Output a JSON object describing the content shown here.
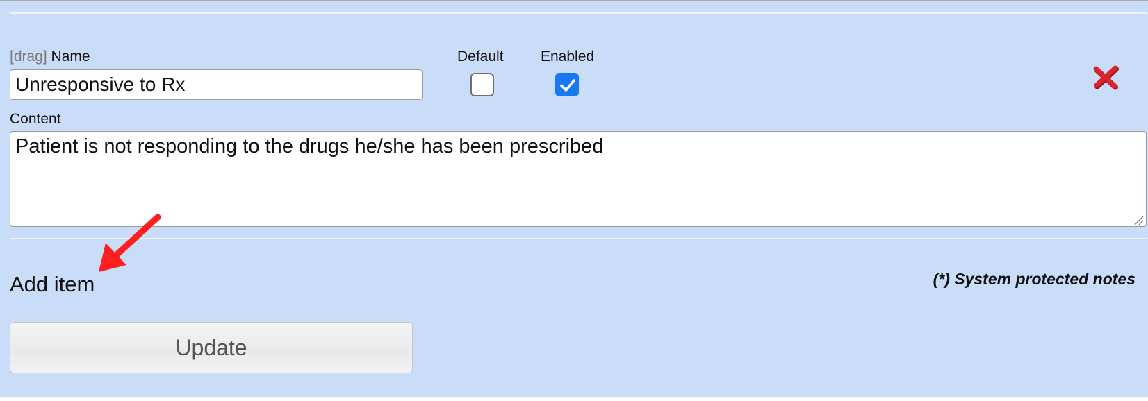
{
  "item": {
    "drag_label": "[drag]",
    "name_label": "Name",
    "name_value": "Unresponsive to Rx",
    "default_label": "Default",
    "default_checked": false,
    "enabled_label": "Enabled",
    "enabled_checked": true,
    "content_label": "Content",
    "content_value": "Patient is not responding to the drugs he/she has been prescribed",
    "delete_icon": "red-x-icon"
  },
  "footer": {
    "add_item_label": "Add item",
    "system_note": "(*) System protected notes",
    "update_label": "Update"
  },
  "annotation": {
    "arrow_color": "#ff1f1f"
  },
  "colors": {
    "panel_background": "#c9ddf9",
    "checkbox_accent": "#1877f2",
    "delete_red": "#d9242b"
  }
}
